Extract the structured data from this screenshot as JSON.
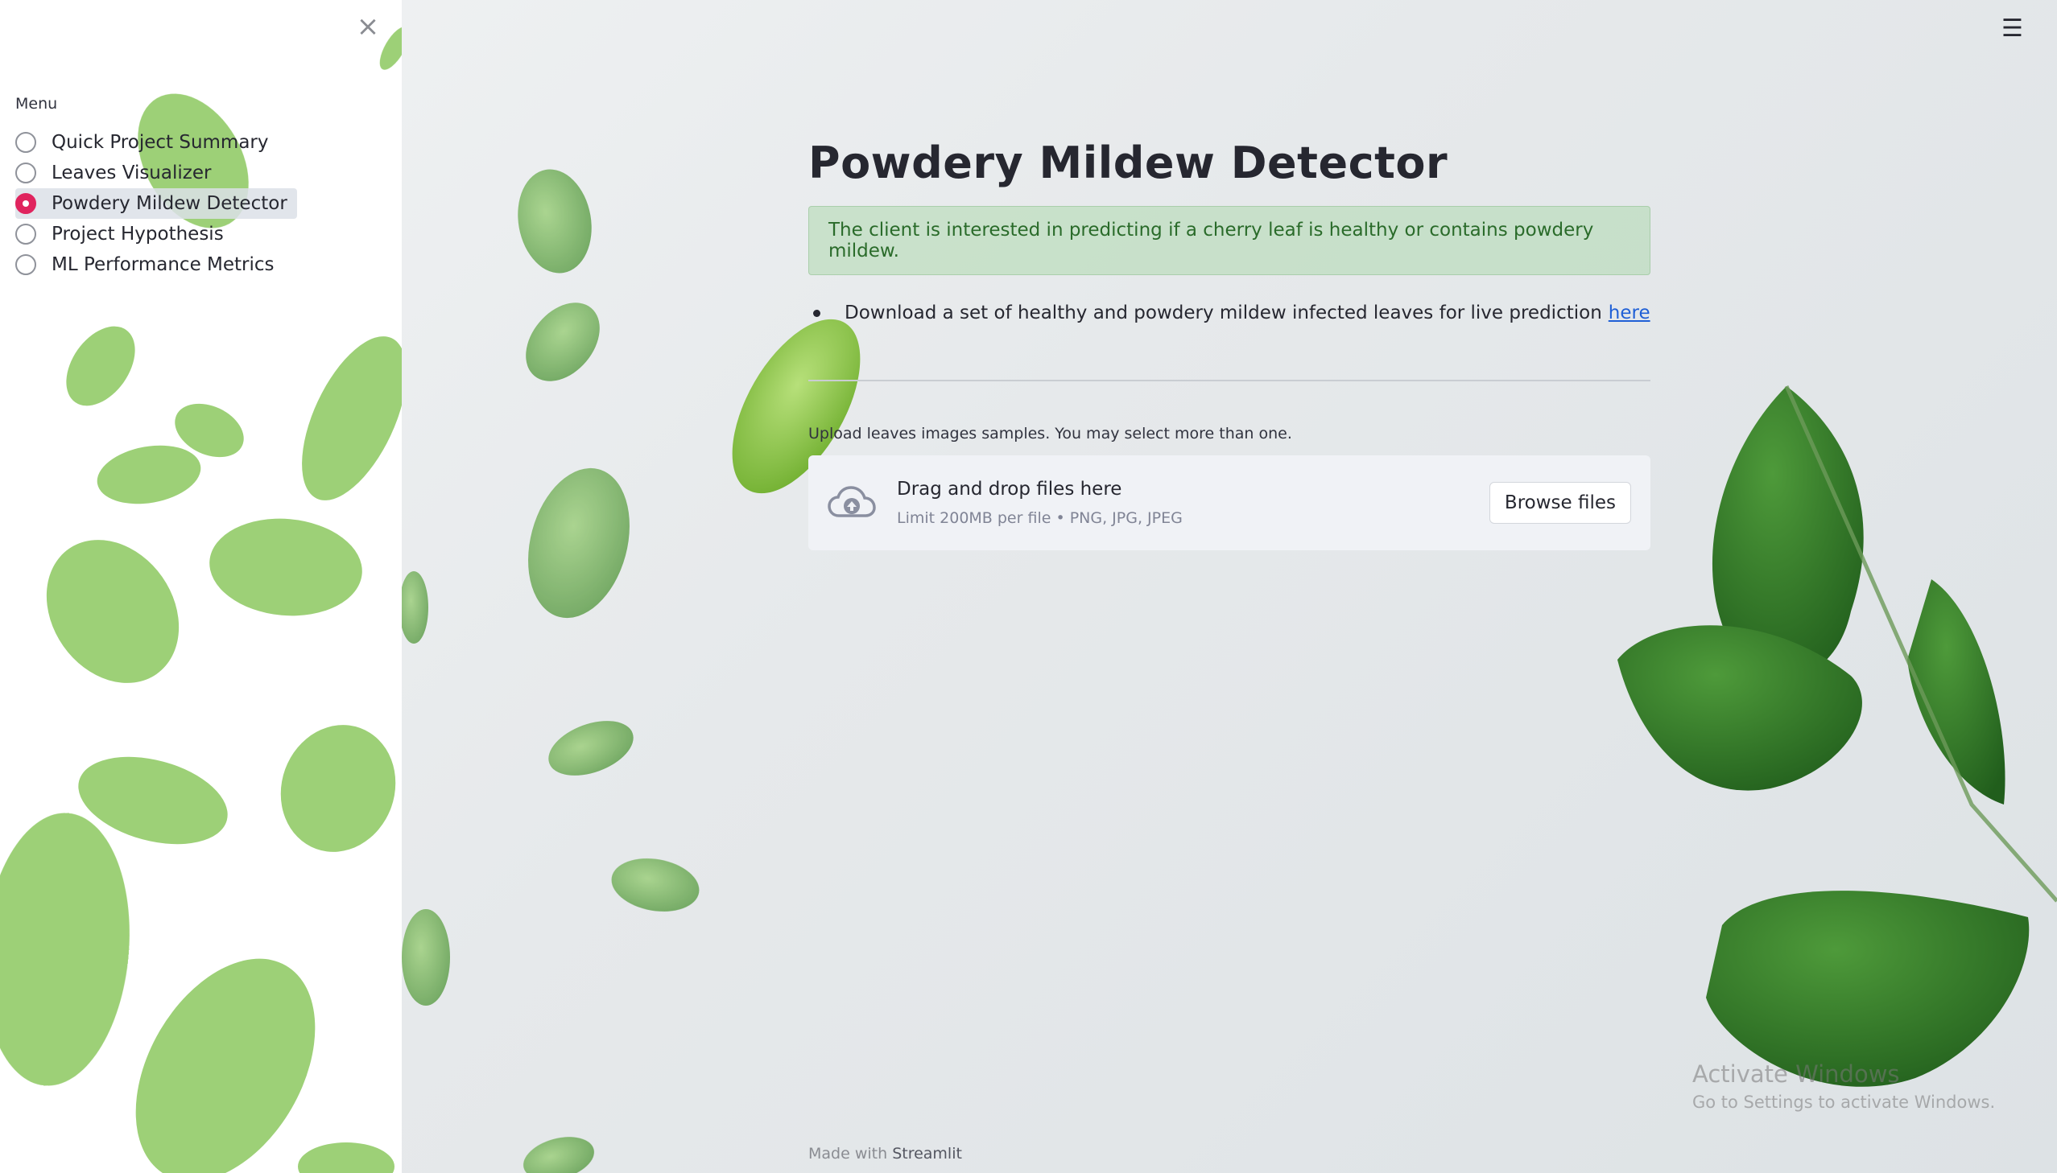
{
  "sidebar": {
    "close_icon": "close-icon",
    "menu_label": "Menu",
    "items": [
      {
        "label": "Quick Project Summary",
        "selected": false
      },
      {
        "label": "Leaves Visualizer",
        "selected": false
      },
      {
        "label": "Powdery Mildew Detector",
        "selected": true
      },
      {
        "label": "Project Hypothesis",
        "selected": false
      },
      {
        "label": "ML Performance Metrics",
        "selected": false
      }
    ]
  },
  "header": {
    "menu_icon": "hamburger-menu-icon"
  },
  "main": {
    "title": "Powdery Mildew Detector",
    "alert": "The client is interested in predicting if a cherry leaf is healthy or contains powdery mildew.",
    "bullet_text": "Download a set of healthy and powdery mildew infected leaves for live prediction",
    "bullet_link": "here",
    "upload_label": "Upload leaves images samples. You may select more than one.",
    "dropzone": {
      "icon": "cloud-upload-icon",
      "title": "Drag and drop files here",
      "limit": "Limit 200MB per file • PNG, JPG, JPEG",
      "browse_label": "Browse files"
    }
  },
  "footer": {
    "prefix": "Made with",
    "brand": "Streamlit"
  },
  "watermark": {
    "line1": "Activate Windows",
    "line2": "Go to Settings to activate Windows."
  },
  "colors": {
    "accent": "#e0245e",
    "alert_bg": "#cde6cd",
    "alert_text": "#2a6b2a",
    "link": "#1f5fd6"
  }
}
